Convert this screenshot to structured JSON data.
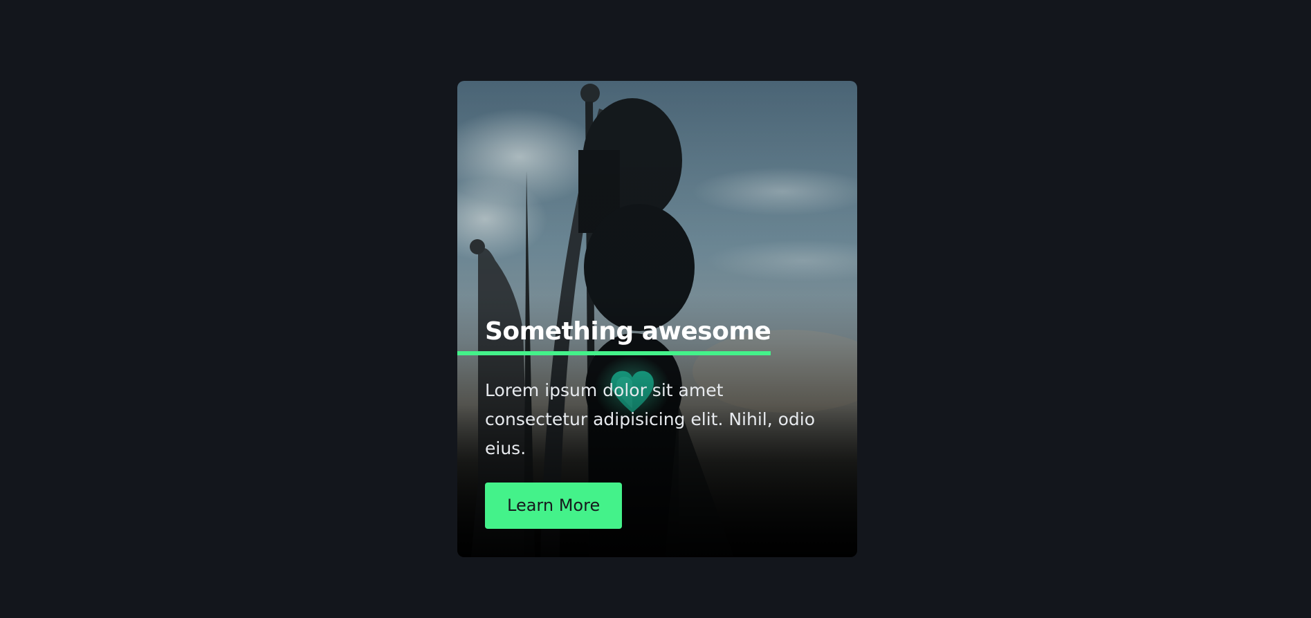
{
  "page": {
    "background_color": "#13161c"
  },
  "card": {
    "image_description_icon": "traffic-light-photo",
    "title": "Something awesome",
    "body": "Lorem ipsum dolor sit amet consectetur adipisicing elit. Nihil, odio eius.",
    "button_label": "Learn More",
    "accent_color": "#44f28a"
  }
}
